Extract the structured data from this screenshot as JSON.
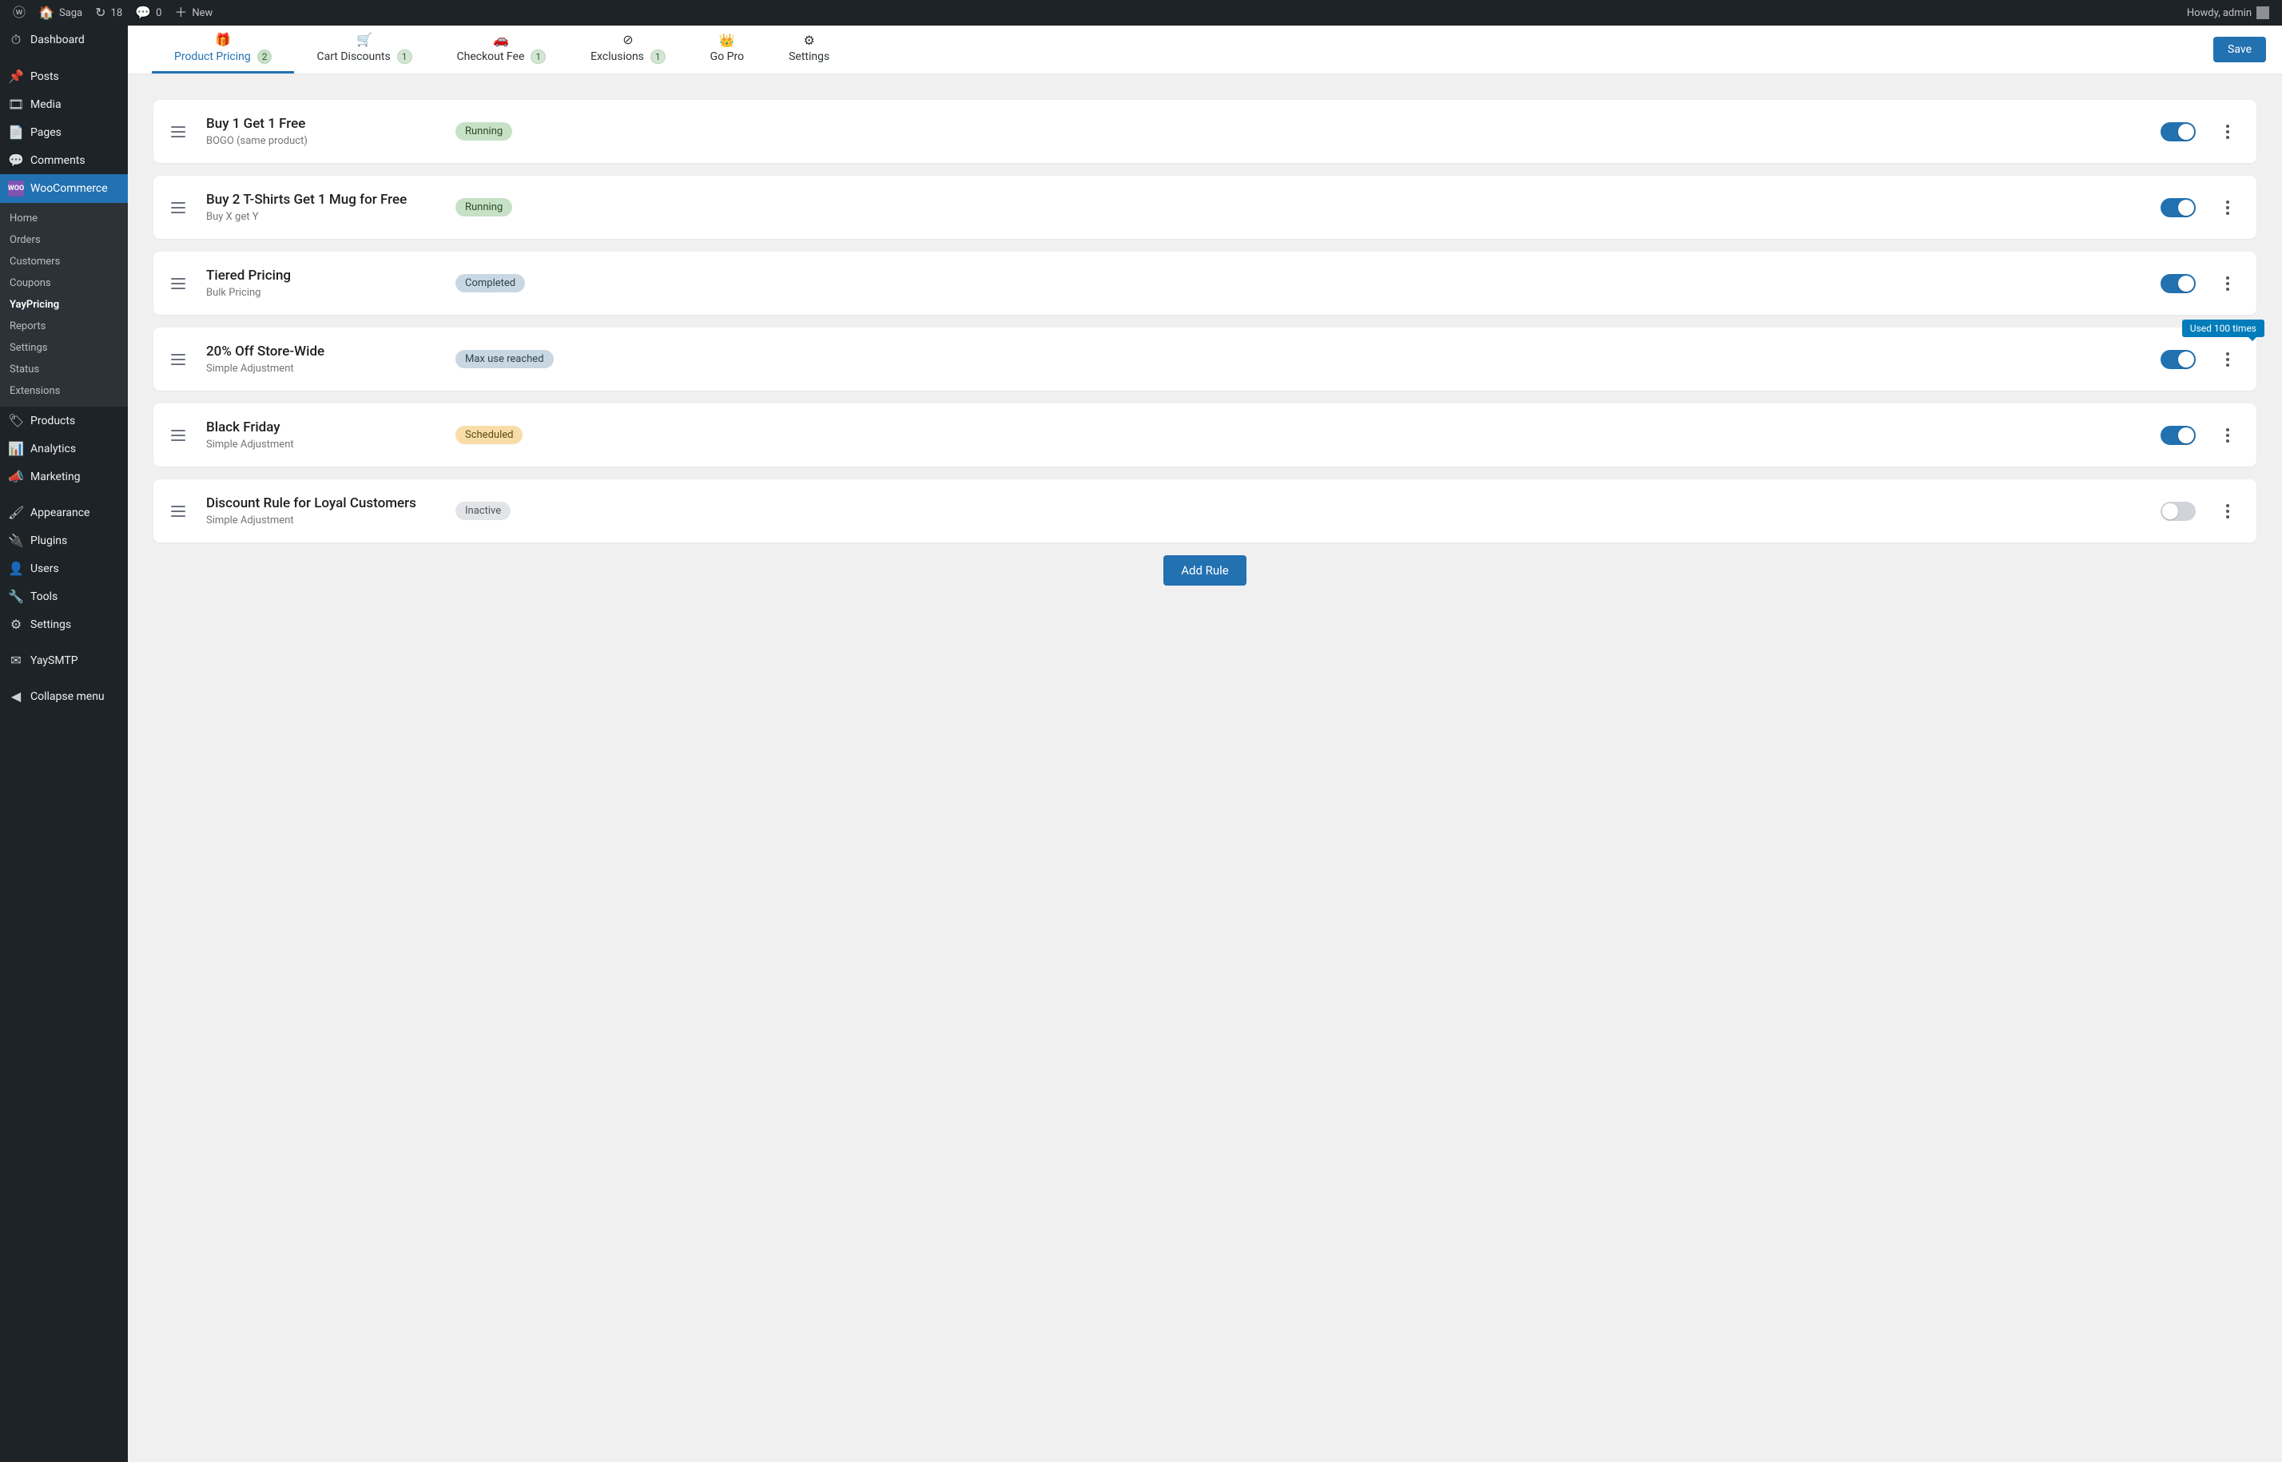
{
  "adminbar": {
    "site_name": "Saga",
    "updates": "18",
    "comments": "0",
    "new_label": "New",
    "howdy": "Howdy, admin"
  },
  "sidebar": {
    "top": [
      {
        "label": "Dashboard",
        "icon": "dashboard-icon"
      },
      {
        "label": "Posts",
        "icon": "pin-icon"
      },
      {
        "label": "Media",
        "icon": "media-icon"
      },
      {
        "label": "Pages",
        "icon": "page-icon"
      },
      {
        "label": "Comments",
        "icon": "comment-icon"
      }
    ],
    "woocommerce_label": "WooCommerce",
    "submenu": [
      {
        "label": "Home"
      },
      {
        "label": "Orders"
      },
      {
        "label": "Customers"
      },
      {
        "label": "Coupons"
      },
      {
        "label": "YayPricing",
        "current": true
      },
      {
        "label": "Reports"
      },
      {
        "label": "Settings"
      },
      {
        "label": "Status"
      },
      {
        "label": "Extensions"
      }
    ],
    "after": [
      {
        "label": "Products",
        "icon": "tag-icon"
      },
      {
        "label": "Analytics",
        "icon": "analytics-icon"
      },
      {
        "label": "Marketing",
        "icon": "megaphone-icon"
      },
      {
        "label": "Appearance",
        "icon": "brush-icon"
      },
      {
        "label": "Plugins",
        "icon": "plugin-icon"
      },
      {
        "label": "Users",
        "icon": "user-icon"
      },
      {
        "label": "Tools",
        "icon": "wrench-icon"
      },
      {
        "label": "Settings",
        "icon": "cog-icon"
      },
      {
        "label": "YaySMTP",
        "icon": "mail-icon"
      },
      {
        "label": "Collapse menu",
        "icon": "collapse-icon"
      }
    ]
  },
  "tabs": [
    {
      "label": "Product Pricing",
      "badge": "2",
      "icon": "gift-icon",
      "active": true
    },
    {
      "label": "Cart Discounts",
      "badge": "1",
      "icon": "cart-icon"
    },
    {
      "label": "Checkout Fee",
      "badge": "1",
      "icon": "cash-icon"
    },
    {
      "label": "Exclusions",
      "badge": "1",
      "icon": "exclude-icon"
    },
    {
      "label": "Go Pro",
      "icon": "crown-icon"
    },
    {
      "label": "Settings",
      "icon": "gear-icon"
    }
  ],
  "save_label": "Save",
  "add_rule_label": "Add Rule",
  "tooltip_used": "Used 100 times",
  "rules": [
    {
      "title": "Buy 1 Get 1 Free",
      "subtitle": "BOGO (same product)",
      "status_label": "Running",
      "status_class": "st-running",
      "enabled": true,
      "tooltip": false
    },
    {
      "title": "Buy 2 T-Shirts Get 1 Mug for Free",
      "subtitle": "Buy X get Y",
      "status_label": "Running",
      "status_class": "st-running",
      "enabled": true,
      "tooltip": false
    },
    {
      "title": "Tiered Pricing",
      "subtitle": "Bulk Pricing",
      "status_label": "Completed",
      "status_class": "st-completed",
      "enabled": true,
      "tooltip": false
    },
    {
      "title": "20% Off Store-Wide",
      "subtitle": "Simple Adjustment",
      "status_label": "Max use reached",
      "status_class": "st-maxuse",
      "enabled": true,
      "tooltip": true
    },
    {
      "title": "Black Friday",
      "subtitle": "Simple Adjustment",
      "status_label": "Scheduled",
      "status_class": "st-scheduled",
      "enabled": true,
      "tooltip": false
    },
    {
      "title": "Discount Rule for Loyal Customers",
      "subtitle": "Simple Adjustment",
      "status_label": "Inactive",
      "status_class": "st-inactive",
      "enabled": false,
      "tooltip": false
    }
  ],
  "icon_glyph": {
    "dashboard-icon": "⏱",
    "pin-icon": "📌",
    "media-icon": "🎞",
    "page-icon": "📄",
    "comment-icon": "💬",
    "tag-icon": "🏷",
    "analytics-icon": "📊",
    "megaphone-icon": "📣",
    "brush-icon": "🖌",
    "plugin-icon": "🔌",
    "user-icon": "👤",
    "wrench-icon": "🔧",
    "cog-icon": "⚙",
    "mail-icon": "✉",
    "collapse-icon": "◀",
    "gift-icon": "🎁",
    "cart-icon": "🛒",
    "cash-icon": "🚗",
    "exclude-icon": "⊘",
    "crown-icon": "👑",
    "gear-icon": "⚙",
    "wp-logo-icon": "ⓦ",
    "home-icon": "🏠",
    "refresh-icon": "↻",
    "plus-icon": "＋",
    "chat-icon": "💬"
  }
}
